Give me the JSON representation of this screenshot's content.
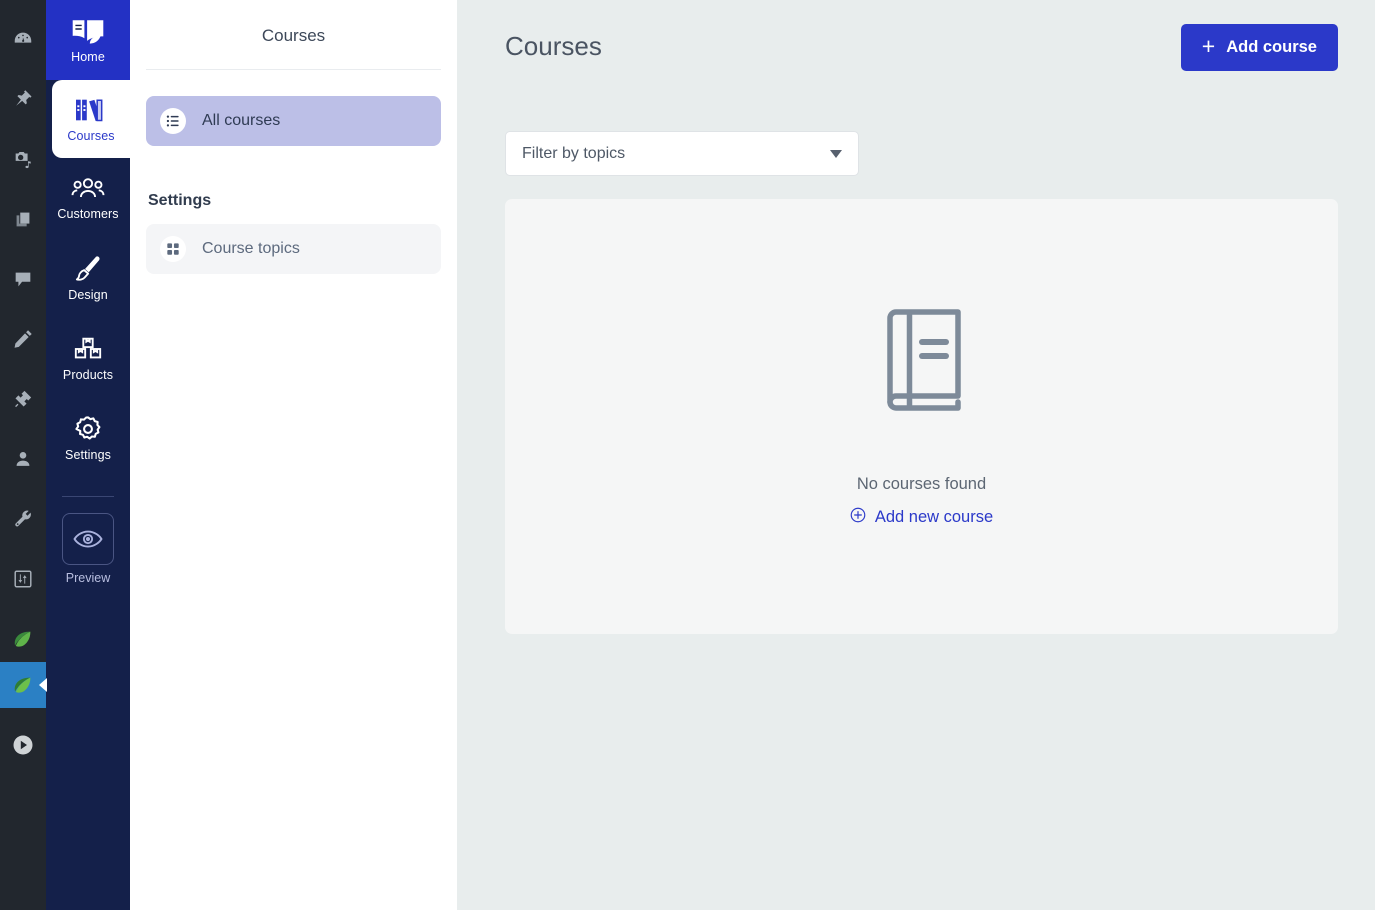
{
  "icon_rail": {
    "items": [
      {
        "name": "dashboard-icon",
        "title": "Dashboard",
        "active": false
      },
      {
        "name": "pin-icon",
        "title": "Pinned",
        "active": false
      },
      {
        "name": "media-icon",
        "title": "Media",
        "active": false
      },
      {
        "name": "pages-icon",
        "title": "Pages",
        "active": false
      },
      {
        "name": "comments-icon",
        "title": "Comments",
        "active": false
      },
      {
        "name": "appearance-icon",
        "title": "Appearance",
        "active": false
      },
      {
        "name": "plugins-icon",
        "title": "Plugins",
        "active": false
      },
      {
        "name": "users-icon",
        "title": "Users",
        "active": false
      },
      {
        "name": "tools-icon",
        "title": "Tools",
        "active": false
      },
      {
        "name": "settings-sliders-icon",
        "title": "Settings",
        "active": false
      },
      {
        "name": "leaf-icon",
        "title": "Leaf",
        "active": false
      },
      {
        "name": "leaf-active-icon",
        "title": "Leaf active",
        "active": true
      },
      {
        "name": "play-icon",
        "title": "Play",
        "active": false
      }
    ]
  },
  "nav_rail": {
    "items": [
      {
        "label": "Home",
        "icon": "book-leaf-icon",
        "state": "home"
      },
      {
        "label": "Courses",
        "icon": "books-icon",
        "state": "selected"
      },
      {
        "label": "Customers",
        "icon": "people-icon",
        "state": "normal"
      },
      {
        "label": "Design",
        "icon": "brush-icon",
        "state": "normal"
      },
      {
        "label": "Products",
        "icon": "boxes-icon",
        "state": "normal"
      },
      {
        "label": "Settings",
        "icon": "gear-icon",
        "state": "normal"
      }
    ],
    "preview": {
      "label": "Preview",
      "icon": "eye-icon"
    }
  },
  "sub_panel": {
    "title": "Courses",
    "items": [
      {
        "label": "All courses",
        "icon": "list-icon",
        "active": true
      }
    ],
    "section_title": "Settings",
    "settings_items": [
      {
        "label": "Course topics",
        "icon": "grid-icon",
        "active": false
      }
    ]
  },
  "main": {
    "page_title": "Courses",
    "add_course_label": "Add course",
    "add_course_plus": "+",
    "filter": {
      "label": "Filter by topics",
      "chevron": "chevron-down-icon"
    },
    "empty_state": {
      "icon": "book-icon",
      "message": "No courses found",
      "link_label": "Add new course",
      "link_icon": "plus-circle-icon"
    }
  },
  "colors": {
    "brand_blue": "#2b39c9",
    "navy": "#14204a",
    "charcoal": "#22272e",
    "active_rail_blue": "#2b80c4",
    "lavender_highlight": "#bcbfe7",
    "page_background": "#e8eded",
    "card_background": "#f5f6f6"
  }
}
